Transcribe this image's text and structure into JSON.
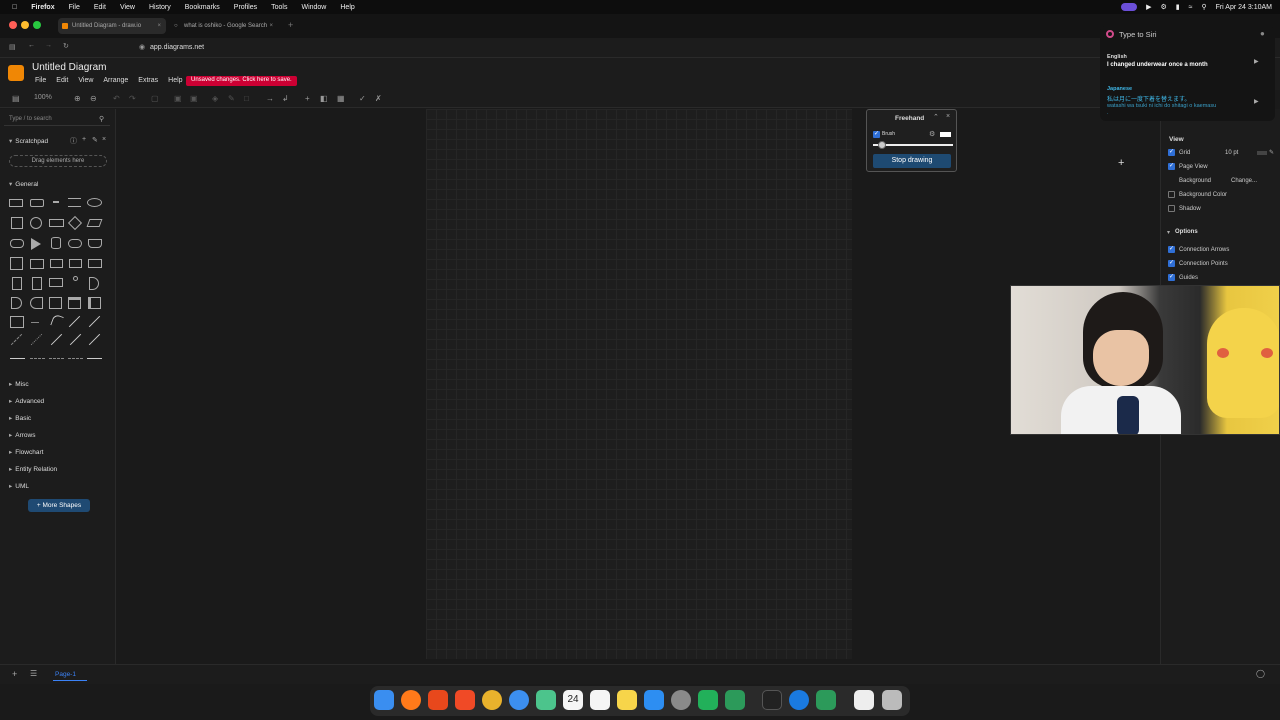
{
  "menubar": {
    "app": "Firefox",
    "items": [
      "File",
      "Edit",
      "View",
      "History",
      "Bookmarks",
      "Profiles",
      "Tools",
      "Window",
      "Help"
    ],
    "datetime": "Fri Apr 24  3:10AM"
  },
  "browser": {
    "tabs": [
      {
        "label": "Untitled Diagram - draw.io"
      },
      {
        "label": "what is oshiko - Google Search"
      }
    ],
    "url": "app.diagrams.net"
  },
  "app": {
    "title": "Untitled Diagram",
    "menus": [
      "File",
      "Edit",
      "View",
      "Arrange",
      "Extras",
      "Help"
    ],
    "unsaved": "Unsaved changes. Click here to save.",
    "zoom": "100%"
  },
  "sidebar": {
    "search_placeholder": "Type / to search",
    "scratchpad": "Scratchpad",
    "drag_hint": "Drag elements here",
    "general": "General",
    "sections": [
      "Misc",
      "Advanced",
      "Basic",
      "Arrows",
      "Flowchart",
      "Entity Relation",
      "UML"
    ],
    "more_shapes": "+ More Shapes"
  },
  "freehand": {
    "title": "Freehand",
    "brush": "Brush",
    "stop": "Stop drawing"
  },
  "rightpanel": {
    "view": "View",
    "grid": "Grid",
    "grid_size": "10 pt",
    "page_view": "Page View",
    "background": "Background",
    "change": "Change...",
    "background_color": "Background Color",
    "shadow": "Shadow",
    "options": "Options",
    "connection_arrows": "Connection Arrows",
    "connection_points": "Connection Points",
    "guides": "Guides"
  },
  "siri": {
    "prompt": "Type to Siri",
    "lang1": "English",
    "text1": "I changed underwear once a month",
    "lang2": "Japanese",
    "text2": "私は月に一度下着を替えます。",
    "romaji": "watashi wa tsuki ni ichi do shitagi o kaemasu ."
  },
  "bottom": {
    "page_tab": "Page-1"
  },
  "dock": {
    "calendar_day": "24"
  },
  "colors": {
    "accent": "#2f6fd6",
    "unsaved": "#cc0033",
    "drawio": "#f08705"
  }
}
